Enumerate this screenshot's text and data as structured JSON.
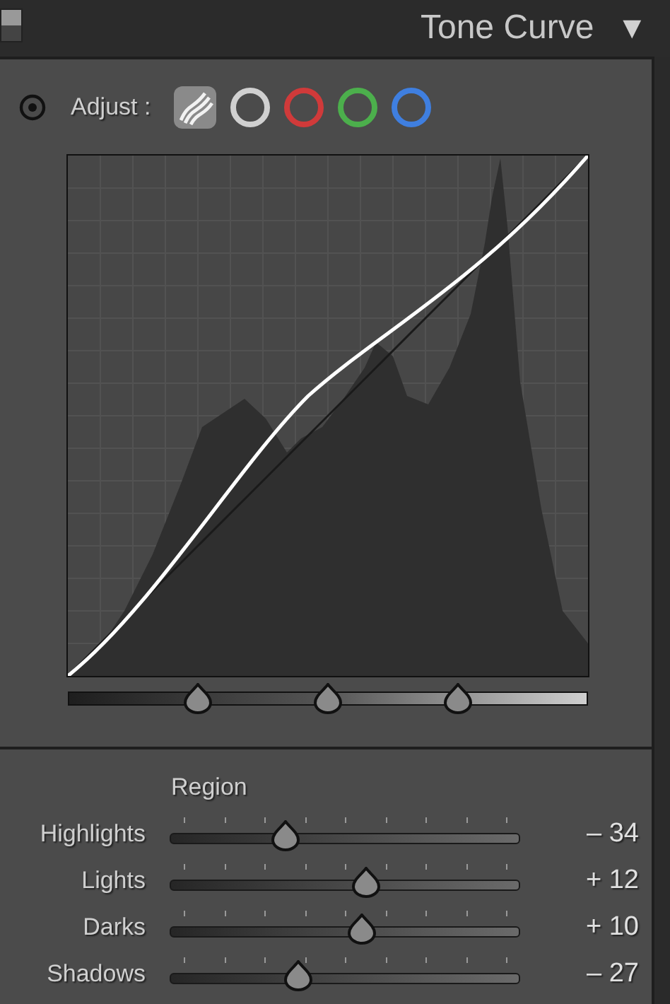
{
  "header": {
    "title": "Tone Curve",
    "collapse_glyph": "▼"
  },
  "adjust": {
    "label": "Adjust :",
    "channels": [
      {
        "kind": "parametric",
        "selected": true
      },
      {
        "kind": "point",
        "color": "#d0d0d0",
        "selected": false
      },
      {
        "kind": "point",
        "color": "#d03a3a",
        "selected": false
      },
      {
        "kind": "point",
        "color": "#4caf4c",
        "selected": false
      },
      {
        "kind": "point",
        "color": "#3f7fe0",
        "selected": false
      }
    ]
  },
  "split_points": [
    {
      "level": 0.25
    },
    {
      "level": 0.5
    },
    {
      "level": 0.75
    }
  ],
  "region": {
    "title": "Region",
    "sliders": [
      {
        "label": "Highlights",
        "level": 0.33,
        "reading": "– 34"
      },
      {
        "label": "Lights",
        "level": 0.56,
        "reading": "+ 12"
      },
      {
        "label": "Darks",
        "level": 0.55,
        "reading": "+ 10"
      },
      {
        "label": "Shadows",
        "level": 0.365,
        "reading": "– 27"
      }
    ]
  }
}
